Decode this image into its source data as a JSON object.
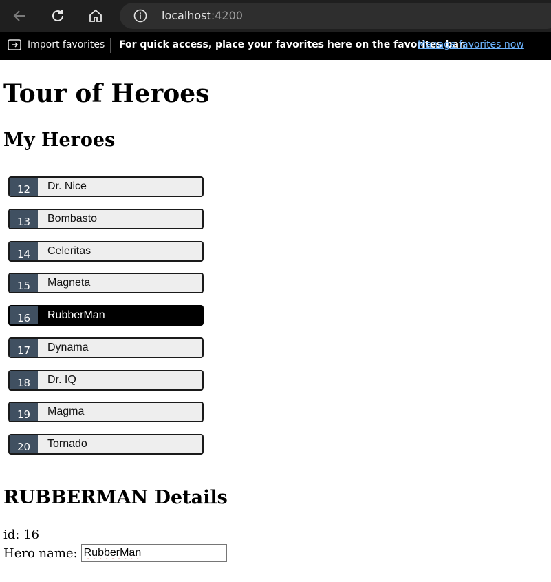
{
  "browser": {
    "address": {
      "host": "localhost",
      "port": ":4200"
    },
    "favorites_bar": {
      "import_label": "Import favorites",
      "message": "For quick access, place your favorites here on the favorites bar.",
      "manage_link": "Manage favorites now"
    }
  },
  "app": {
    "title": "Tour of Heroes",
    "list_title": "My Heroes",
    "heroes": [
      {
        "id": "12",
        "name": "Dr. Nice"
      },
      {
        "id": "13",
        "name": "Bombasto"
      },
      {
        "id": "14",
        "name": "Celeritas"
      },
      {
        "id": "15",
        "name": "Magneta"
      },
      {
        "id": "16",
        "name": "RubberMan",
        "selected": true
      },
      {
        "id": "17",
        "name": "Dynama"
      },
      {
        "id": "18",
        "name": "Dr. IQ"
      },
      {
        "id": "19",
        "name": "Magma"
      },
      {
        "id": "20",
        "name": "Tornado"
      }
    ],
    "details": {
      "title": "RUBBERMAN Details",
      "id_text": "id: 16",
      "name_label": "Hero name:",
      "name_value": "RubberMan"
    }
  },
  "colors": {
    "badge": "#405061",
    "selected": "#000000",
    "item_bg": "#eeeeee",
    "link": "#6cb4ff"
  }
}
